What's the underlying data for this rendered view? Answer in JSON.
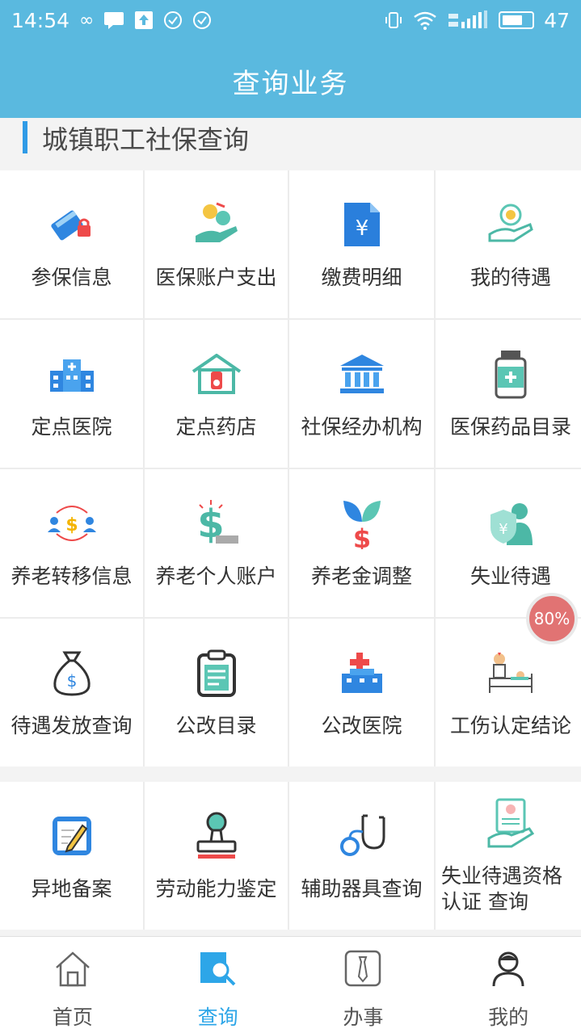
{
  "status": {
    "time": "14:54",
    "battery": "47"
  },
  "header": {
    "title": "查询业务"
  },
  "section": {
    "title": "城镇职工社保查询"
  },
  "grid": [
    {
      "label": "参保信息",
      "icon": "insurance-card-icon"
    },
    {
      "label": "医保账户支出",
      "icon": "coin-hand-icon"
    },
    {
      "label": "缴费明细",
      "icon": "yuan-document-icon"
    },
    {
      "label": "我的待遇",
      "icon": "coin-hand-icon"
    },
    {
      "label": "定点医院",
      "icon": "hospital-icon"
    },
    {
      "label": "定点药店",
      "icon": "pharmacy-icon"
    },
    {
      "label": "社保经办机构",
      "icon": "institution-icon"
    },
    {
      "label": "医保药品目录",
      "icon": "medicine-bottle-icon"
    },
    {
      "label": "养老转移信息",
      "icon": "transfer-people-icon"
    },
    {
      "label": "养老个人账户",
      "icon": "dollar-account-icon"
    },
    {
      "label": "养老金调整",
      "icon": "dollar-plant-icon"
    },
    {
      "label": "失业待遇",
      "icon": "shield-person-icon"
    },
    {
      "label": "待遇发放查询",
      "icon": "money-bag-icon"
    },
    {
      "label": "公改目录",
      "icon": "clipboard-icon"
    },
    {
      "label": "公改医院",
      "icon": "red-cross-building-icon"
    },
    {
      "label": "工伤认定结论",
      "icon": "doctor-bed-icon"
    }
  ],
  "grid2": [
    {
      "label": "异地备案",
      "icon": "edit-note-icon"
    },
    {
      "label": "劳动能力鉴定",
      "icon": "stamp-icon"
    },
    {
      "label": "辅助器具查询",
      "icon": "stethoscope-icon"
    },
    {
      "label": "失业待遇资格认证 查询",
      "icon": "certificate-hand-icon"
    }
  ],
  "badge": {
    "text": "80%"
  },
  "tabs": [
    {
      "label": "首页",
      "icon": "home-icon",
      "active": false
    },
    {
      "label": "查询",
      "icon": "search-doc-icon",
      "active": true
    },
    {
      "label": "办事",
      "icon": "tie-icon",
      "active": false
    },
    {
      "label": "我的",
      "icon": "user-icon",
      "active": false
    }
  ]
}
